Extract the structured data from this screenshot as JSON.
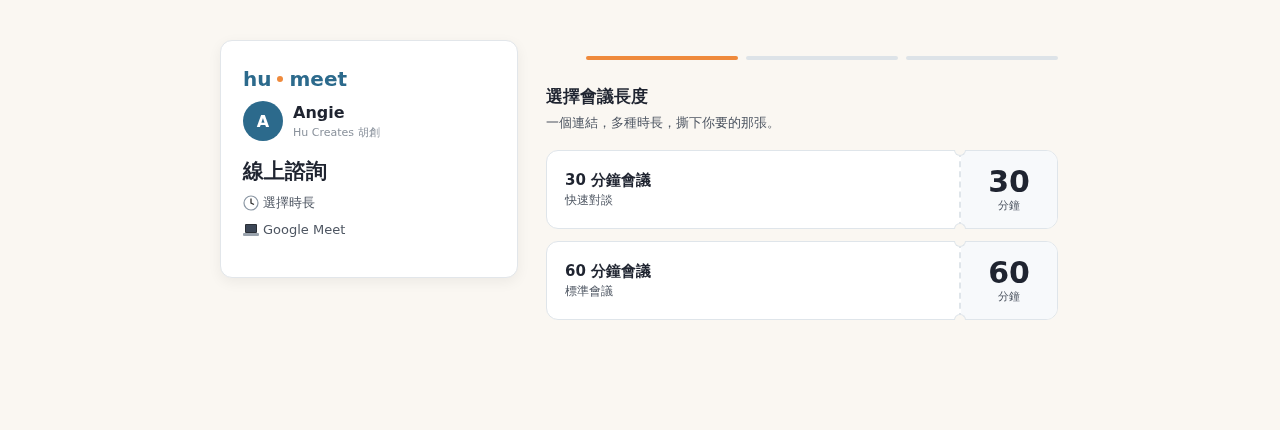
{
  "profile_card": {
    "logo": {
      "left": "hu",
      "right": "meet"
    },
    "avatar": "A",
    "name": "Angie",
    "organization": "Hu Creates 胡創",
    "title": "線上諮詢",
    "details": [
      {
        "kind": "clock",
        "text": "選擇時長"
      },
      {
        "kind": "laptop",
        "text": "Google Meet"
      }
    ]
  },
  "steps": [
    {
      "active": true
    },
    {
      "active": false
    },
    {
      "active": false
    }
  ],
  "heading": "選擇會議長度",
  "subheading": "一個連結，多種時長，撕下你要的那張。",
  "options": [
    {
      "title": "30 分鐘會議",
      "subtitle": "快速對談",
      "number": "30",
      "unit": "分鐘"
    },
    {
      "title": "60 分鐘會議",
      "subtitle": "標準會議",
      "number": "60",
      "unit": "分鐘"
    }
  ]
}
